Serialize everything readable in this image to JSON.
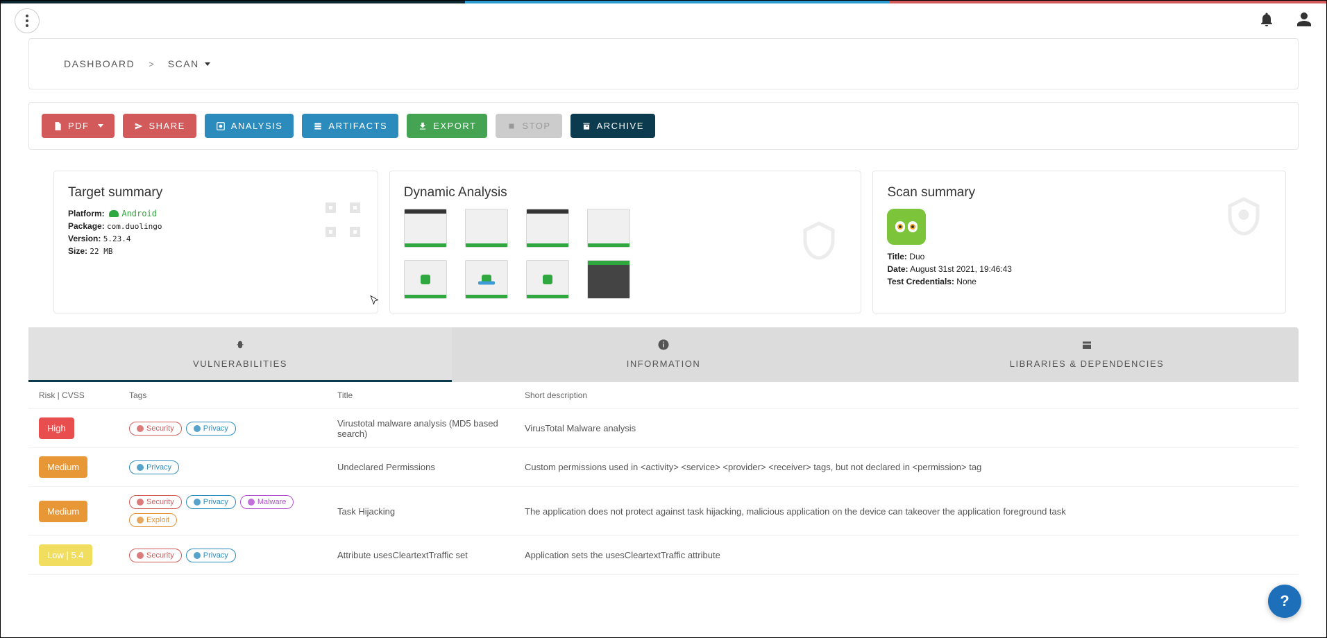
{
  "breadcrumb": {
    "dashboard": "DASHBOARD",
    "sep": ">",
    "scan": "SCAN"
  },
  "actions": {
    "pdf": "PDF",
    "share": "SHARE",
    "analysis": "ANALYSIS",
    "artifacts": "ARTIFACTS",
    "export": "EXPORT",
    "stop": "STOP",
    "archive": "ARCHIVE"
  },
  "target": {
    "title": "Target summary",
    "platform_label": "Platform:",
    "platform_value": "Android",
    "package_label": "Package:",
    "package_value": "com.duolingo",
    "version_label": "Version:",
    "version_value": "5.23.4",
    "size_label": "Size:",
    "size_value": "22 MB"
  },
  "dynamic": {
    "title": "Dynamic Analysis"
  },
  "scan": {
    "title": "Scan summary",
    "title_label": "Title:",
    "title_value": "Duo",
    "date_label": "Date:",
    "date_value": "August 31st 2021, 19:46:43",
    "creds_label": "Test Credentials:",
    "creds_value": "None"
  },
  "tabs": {
    "vuln": "VULNERABILITIES",
    "info": "INFORMATION",
    "libs": "LIBRARIES & DEPENDENCIES"
  },
  "table": {
    "headers": {
      "risk": "Risk | CVSS",
      "tags": "Tags",
      "title": "Title",
      "desc": "Short description"
    },
    "rows": [
      {
        "risk": "High",
        "risk_class": "r-high",
        "tags": [
          "Security",
          "Privacy"
        ],
        "title": "Virustotal malware analysis (MD5 based search)",
        "desc": "VirusTotal Malware analysis"
      },
      {
        "risk": "Medium",
        "risk_class": "r-med",
        "tags": [
          "Privacy"
        ],
        "title": "Undeclared Permissions",
        "desc": "Custom permissions used in <activity> <service> <provider> <receiver> tags, but not declared in <permission> tag"
      },
      {
        "risk": "Medium",
        "risk_class": "r-med",
        "tags": [
          "Security",
          "Privacy",
          "Malware",
          "Exploit"
        ],
        "title": "Task Hijacking",
        "desc": "The application does not protect against task hijacking, malicious application on the device can takeover the application foreground task"
      },
      {
        "risk": "Low  |  5.4",
        "risk_class": "r-low",
        "tags": [
          "Security",
          "Privacy"
        ],
        "title": "Attribute usesCleartextTraffic set",
        "desc": "Application sets the usesCleartextTraffic attribute"
      }
    ]
  },
  "help": "?"
}
